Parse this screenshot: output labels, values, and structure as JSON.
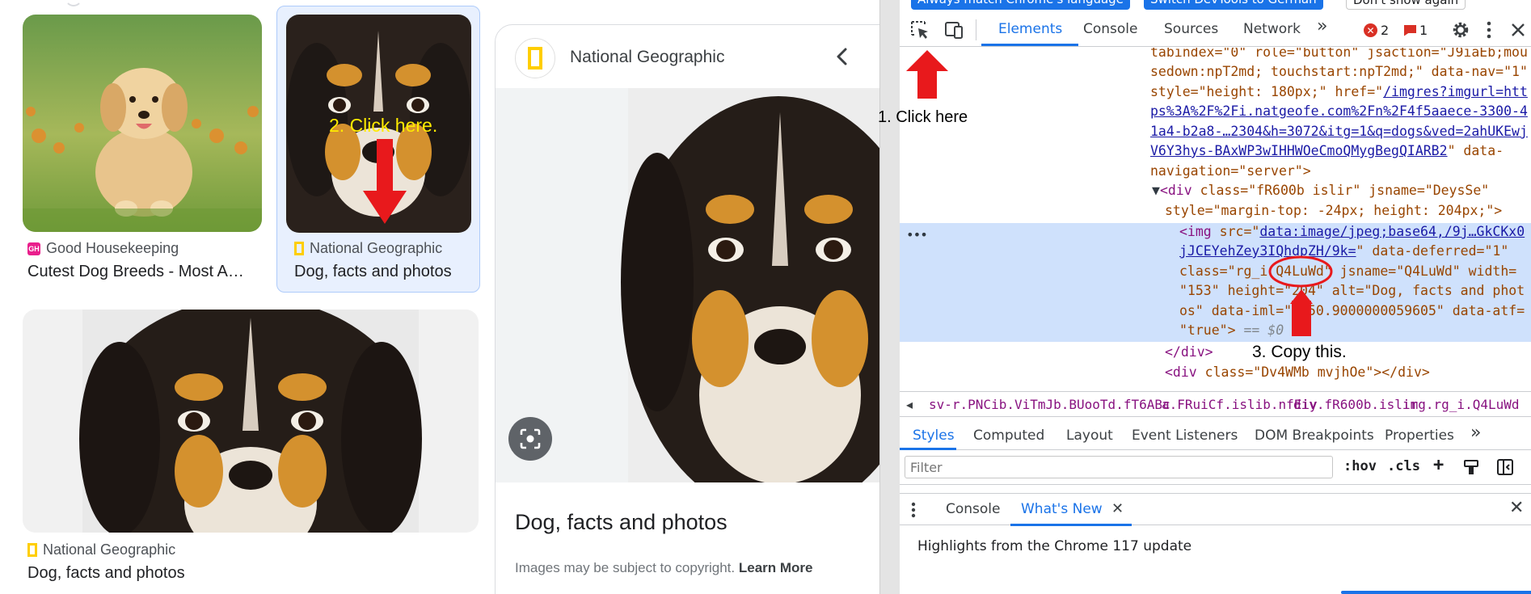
{
  "results": [
    {
      "source": "Good Housekeeping",
      "title": "Cutest Dog Breeds - Most A…",
      "source_icon": "gh-logo-icon"
    },
    {
      "source": "National Geographic",
      "title": "Dog, facts and photos",
      "source_icon": "ng-logo-icon"
    },
    {
      "source": "National Geographic",
      "title": "Dog, facts and photos",
      "source_icon": "ng-logo-icon"
    }
  ],
  "side_panel": {
    "source": "National Geographic",
    "title": "Dog, facts and photos",
    "copyright_text": "Images may be subject to copyright. ",
    "learn_more": "Learn More"
  },
  "devtools": {
    "infobar": {
      "btn_language": "Always match Chrome's language",
      "btn_german": "Switch DevTools to German",
      "btn_dont_show": "Don't show again"
    },
    "tabs": [
      "Elements",
      "Console",
      "Sources",
      "Network"
    ],
    "more_tabs": "»",
    "errors": "2",
    "issues": "1",
    "breadcrumbs": [
      "sv-r.PNCib.ViTmJb.BUooTd.fT6ABc",
      "a.FRuiCf.islib.nfEiy",
      "div.fR600b.islir",
      "img.rg_i.Q4LuWd"
    ],
    "styles_tabs": [
      "Styles",
      "Computed",
      "Layout",
      "Event Listeners",
      "DOM Breakpoints",
      "Properties"
    ],
    "filter_placeholder": "Filter",
    "filter_tools": [
      ":hov",
      ".cls",
      "+"
    ],
    "drawer_tabs": [
      "Console",
      "What's New"
    ],
    "highlights_text": "Highlights from the Chrome 117 update",
    "code": {
      "l1_attr": "tabindex=\"0\" role=\"button\" jsaction=\"J9iaEb;mou",
      "l2": "sedown:npT2md; touchstart:npT2md;\" data-nav=\"1\"",
      "l3a": "style=\"height: 180px;\" href=\"",
      "l3b": "/imgres?imgurl=htt",
      "l4": "ps%3A%2F%2Fi.natgeofe.com%2Fn%2F4f5aaece-3300-4",
      "l5": "1a4-b2a8-…2304&h=3072&itg=1&q=dogs&ved=2ahUKEwj",
      "l6a": "V6Y3hys-BAxWP3wIHHWOeCmoQMygBegQIARB2",
      "l6b": "\" data-",
      "l7": "navigation=\"server\">",
      "l8a": "<div ",
      "l8b": "class=\"fR600b islir\" jsname=\"DeysSe\"",
      "l9": "style=\"margin-top: -24px; height: 204px;\">",
      "l10a": "<img ",
      "l10b": "src=\"",
      "l10c": "data:image/jpeg;base64,/9j…GkCKx0",
      "l11a": "jJCEYehZey3IQhdpZH/9k=",
      "l11b": "\" data-deferred=\"1\"",
      "l12": "class=\"rg_i Q4LuWd\" jsname=\"Q4LuWd\" width=",
      "l13": "\"153\" height=\"204\" alt=\"Dog, facts and phot",
      "l14": "os\" data-iml=\"1250.9000000059605\" data-atf=",
      "l15": "\"true\">",
      "l15b": " == $0",
      "l16": "</div>",
      "l17a": "<div ",
      "l17b": "class=\"Dv4WMb mvjhOe\"></div>"
    }
  },
  "annotations": {
    "step1": "1. Click here",
    "step2": "2. Click here.",
    "step3": "3. Copy this."
  },
  "colors": {
    "accent": "#1a73e8",
    "annotation_red": "#e8191c",
    "step2_text": "#ffeb00",
    "selection": "#cfe1fc"
  }
}
